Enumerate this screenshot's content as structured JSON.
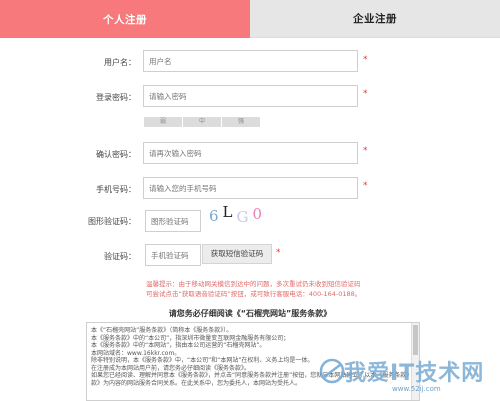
{
  "tabs": [
    {
      "label": "个人注册",
      "active": true
    },
    {
      "label": "企业注册",
      "active": false
    }
  ],
  "form": {
    "username": {
      "label": "用户名：",
      "placeholder": "用户名"
    },
    "password": {
      "label": "登录密码：",
      "placeholder": "请输入密码"
    },
    "strength": [
      "弱",
      "中",
      "强"
    ],
    "confirm": {
      "label": "确认密码：",
      "placeholder": "请再次输入密码"
    },
    "phone": {
      "label": "手机号码：",
      "placeholder": "请输入您的手机号码"
    },
    "captcha": {
      "label": "图形验证码：",
      "placeholder": "图形验证码",
      "code": [
        "6",
        "L",
        "G",
        "0"
      ]
    },
    "sms": {
      "label": "验证码：",
      "placeholder": "手机验证码",
      "button": "获取短信验证码"
    },
    "required_mark": "*"
  },
  "warning": [
    "温馨提示：由于移动网关模信到达中的问题，多次重试仍未收到短信验证码",
    "可尝试点击“获取语音验证码”按钮，或可致行客服电话：400-164-0188。"
  ],
  "terms": {
    "title": "请您务必仔细阅读《“石榴壳网站”服务条款》",
    "lines": [
      "本《“石榴壳网站”服务条款》（简称本《服务条款》）。",
      "本《服务条款》中的“本公司”，指深圳市微量变互联网金融服务有限公司；",
      "本《服务条款》中的“本网站”，指由本公司运营的“石榴壳网站”。",
      "本网站域名：www.16kkr.com。",
      "除非特别说明，本《服务条款》中，“本公司”和“本网站”在权利、义务上均是一体。",
      "在注册成为本网站用户前，请您务必仔细阅读《服务条款》。",
      "如果您已经阅读、理解并同意本《服务条款》，并点击“同意服务条款并注册”按钮，您就与本网站建立了以本《服务条款》",
      "款》为内容的网站服务合同关系。在此关系中，您为委托人，本网站为受托人。"
    ]
  },
  "watermark": {
    "text": "我爱IT技术网",
    "url": "www.52ij.com"
  },
  "colors": {
    "accent": "#f7797b",
    "required": "#e2363a",
    "warning": "#e06a6a"
  }
}
